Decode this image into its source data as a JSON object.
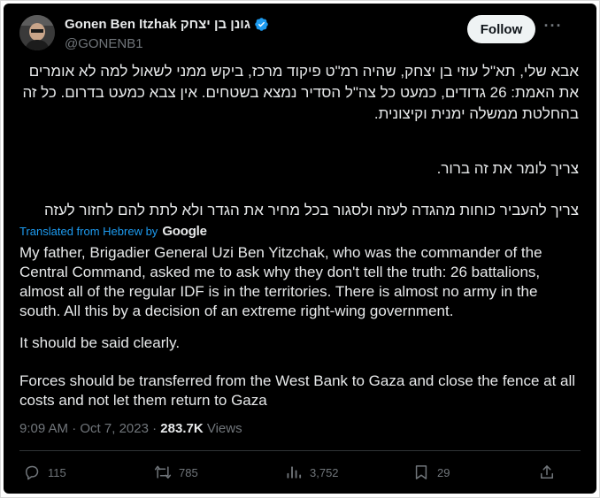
{
  "author": {
    "name": "Gonen Ben Itzhak גונן בן יצחק",
    "handle": "@GONENB1"
  },
  "follow_label": "Follow",
  "post": {
    "hebrew_p1": "אבא שלי, תא\"ל עוזי בן יצחק, שהיה רמ\"ט פיקוד מרכז, ביקש ממני לשאול למה לא אומרים את האמת: 26 גדודים, כמעט כל צה\"ל הסדיר נמצא בשטחים. אין צבא כמעט בדרום. כל זה בהחלטת ממשלה ימנית וקיצונית.",
    "hebrew_p2": "צריך לומר את זה ברור.",
    "hebrew_p3": "צריך להעביר כוחות מהגדה לעזה ולסגור בכל מחיר את הגדר ולא לתת להם לחזור לעזה",
    "translated_label": "Translated from Hebrew by",
    "translator": "Google",
    "english_p1": "My father, Brigadier General Uzi Ben Yitzchak, who was the commander of the Central Command, asked me to ask why they don't tell the truth: 26 battalions, almost all of the regular IDF is in the territories. There is almost no army in the south. All this by a decision of an extreme right-wing government.",
    "english_p2": "It should be said clearly.",
    "english_p3": "Forces should be transferred from the West Bank to Gaza and close the fence at all costs and not let them return to Gaza"
  },
  "meta": {
    "time": "9:09 AM",
    "separator": "·",
    "date": "Oct 7, 2023",
    "views_count": "283.7K",
    "views_label": "Views"
  },
  "actions": {
    "replies": "115",
    "reposts": "785",
    "views": "3,752",
    "bookmarks": "29"
  },
  "colors": {
    "background": "#000000",
    "text": "#e7e9ea",
    "muted": "#71767b",
    "link": "#1d9bf0",
    "verified": "#1d9bf0",
    "button_bg": "#eff3f4"
  },
  "icons": [
    "verified-badge-icon",
    "more-icon",
    "reply-icon",
    "repost-icon",
    "views-icon",
    "bookmark-icon",
    "share-icon"
  ]
}
